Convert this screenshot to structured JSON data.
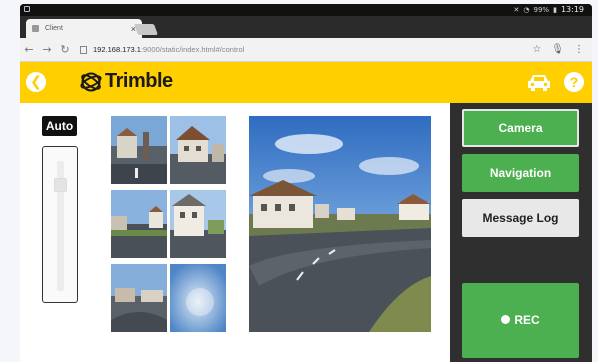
{
  "statusbar": {
    "battery": "99%",
    "time": "13:19"
  },
  "browser": {
    "tab_title": "Client",
    "tab_close": "×",
    "url_host": "192.168.173.1",
    "url_path": ":9000/static/index.html#/control"
  },
  "header": {
    "logo_text": "Trimble"
  },
  "controls": {
    "auto_label": "Auto",
    "slider_level": 0.15
  },
  "sidepanel": {
    "camera_label": "Camera",
    "navigation_label": "Navigation",
    "messagelog_label": "Message Log",
    "rec_label": "REC"
  },
  "colors": {
    "header_yellow": "#ffcf00",
    "green": "#4caf50",
    "panel_dark": "#2f2f2f"
  },
  "icons": {
    "back": "arrow-left-icon",
    "car": "car-icon",
    "help": "question-icon"
  }
}
